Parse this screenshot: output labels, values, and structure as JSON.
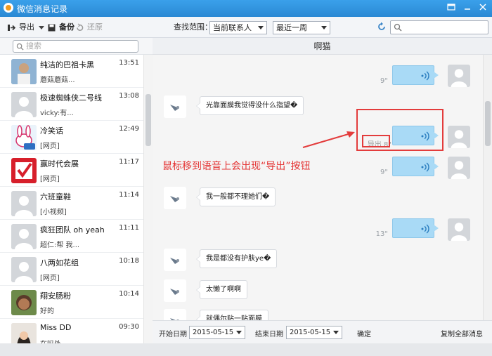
{
  "window": {
    "title": "微信消息记录"
  },
  "toolbar": {
    "export_label": "导出",
    "backup_label": "备份",
    "restore_label": "还原",
    "scope_label": "查找范围：",
    "scope_value": "当前联系人",
    "period_value": "最近一周",
    "search_placeholder": ""
  },
  "sidebar": {
    "search_placeholder": "搜索",
    "contacts": [
      {
        "name": "纯洁的巴祖卡黑",
        "time": "13:51",
        "preview": "蘑菇蘑菇...",
        "avatar": "photo-man"
      },
      {
        "name": "极速蜘蛛侠二号线",
        "time": "13:08",
        "preview": "vicky:有...",
        "avatar": "default"
      },
      {
        "name": "冷笑话",
        "time": "12:49",
        "preview": "[网页]",
        "avatar": "rabbit"
      },
      {
        "name": "赢时代会展",
        "time": "11:17",
        "preview": "[网页]",
        "avatar": "check"
      },
      {
        "name": "六班童鞋",
        "time": "11:14",
        "preview": "[小视频]",
        "avatar": "default"
      },
      {
        "name": "疯狂团队 oh yeah",
        "time": "11:11",
        "preview": "超仁:帮 我...",
        "avatar": "default"
      },
      {
        "name": "八两如花组",
        "time": "10:18",
        "preview": "[网页]",
        "avatar": "default"
      },
      {
        "name": "翔安肠粉",
        "time": "10:14",
        "preview": "好的",
        "avatar": "photo-child"
      },
      {
        "name": "Miss DD",
        "time": "09:30",
        "preview": "在吗处",
        "avatar": "photo-girl"
      }
    ]
  },
  "chat": {
    "contact_name": "啊猫",
    "messages": [
      {
        "kind": "voice",
        "duration": "9\""
      },
      {
        "kind": "text",
        "text": "光靠面膜我觉得没什么指望�"
      },
      {
        "kind": "voice",
        "duration": "8\"",
        "export_hint": "导出"
      },
      {
        "kind": "voice",
        "duration": "9\""
      },
      {
        "kind": "text",
        "text": "我一般都不理她们�"
      },
      {
        "kind": "voice",
        "duration": "13\""
      },
      {
        "kind": "text",
        "text": "我是都没有护肤ye�"
      },
      {
        "kind": "text",
        "text": "太懒了啊啊"
      },
      {
        "kind": "text",
        "text": "就偶尔贴一贴面膜"
      }
    ],
    "annotation": "鼠标移到语音上会出现“导出”按钮"
  },
  "footer": {
    "start_label": "开始日期",
    "start_date": "2015-05-15",
    "end_label": "结束日期",
    "end_date": "2015-05-15",
    "confirm_label": "确定",
    "copy_all_label": "复制全部消息"
  },
  "colors": {
    "accent": "#2b8fd8",
    "voice_bubble": "#a9daf6",
    "highlight": "#e33c3c"
  }
}
